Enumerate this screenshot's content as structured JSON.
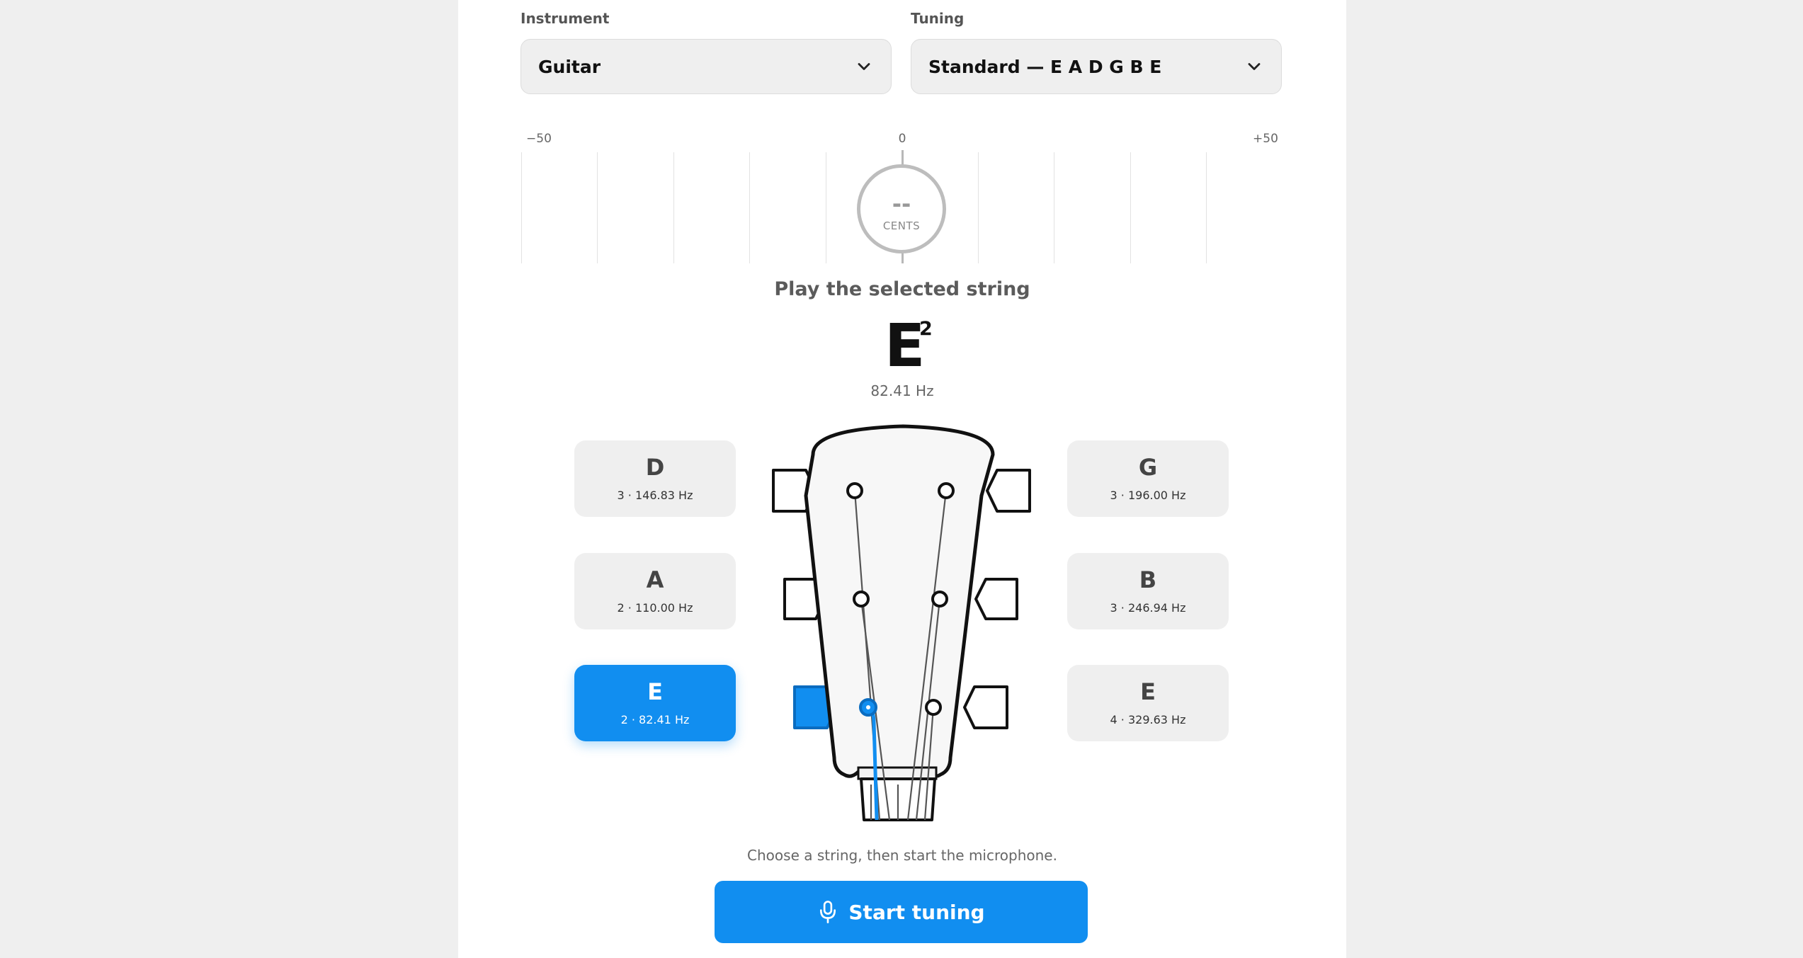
{
  "instrument": {
    "label": "Instrument",
    "value": "Guitar"
  },
  "tuning": {
    "label": "Tuning",
    "value": "Standard — E A D G B E"
  },
  "meter": {
    "min_label": "−50",
    "center_label": "0",
    "max_label": "+50",
    "value": "--",
    "unit": "CENTS"
  },
  "prompt": "Play the selected string",
  "current": {
    "note": "E",
    "octave": "2",
    "frequency": "82.41 Hz"
  },
  "strings": {
    "d3": {
      "note": "D",
      "detail": "3 · 146.83 Hz"
    },
    "a2": {
      "note": "A",
      "detail": "2 · 110.00 Hz"
    },
    "e2": {
      "note": "E",
      "detail": "2 · 82.41 Hz"
    },
    "g3": {
      "note": "G",
      "detail": "3 · 196.00 Hz"
    },
    "b3": {
      "note": "B",
      "detail": "3 · 246.94 Hz"
    },
    "e4": {
      "note": "E",
      "detail": "4 · 329.63 Hz"
    }
  },
  "hint": "Choose a string, then start the microphone.",
  "start_button": "Start tuning",
  "colors": {
    "accent": "#118ef0",
    "panel": "#ffffff",
    "background": "#efefef"
  },
  "icons": {
    "dropdown": "chevron-down-icon",
    "mic": "microphone-icon"
  }
}
